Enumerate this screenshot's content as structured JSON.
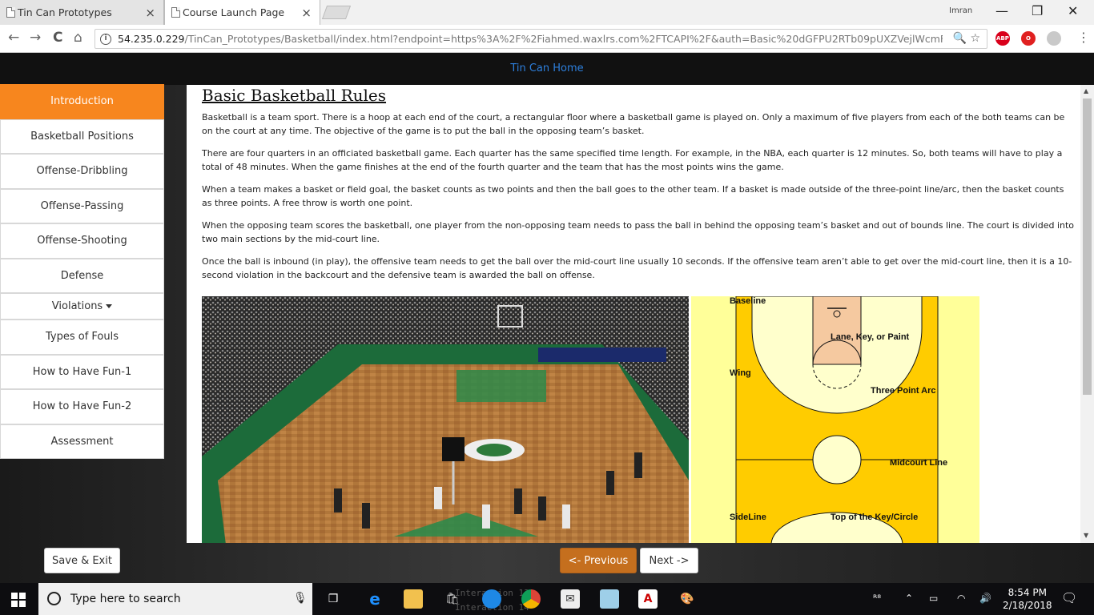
{
  "browser": {
    "tabs": [
      {
        "title": "Tin Can Prototypes",
        "close": "×"
      },
      {
        "title": "Course Launch Page",
        "close": "×"
      }
    ],
    "user_label": "Imran",
    "window_controls": {
      "minimize": "—",
      "maximize": "❐",
      "close": "✕"
    },
    "nav": {
      "back": "←",
      "forward": "→",
      "reload": "C",
      "home": "⌂"
    },
    "url_host": "54.235.0.229",
    "url_path": "/TinCan_Prototypes/Basketball/index.html?endpoint=https%3A%2F%2Fiahmed.waxlrs.com%2FTCAPI%2F&auth=Basic%20dGFPU2RTb09pUXZVejlWcmF2...",
    "omnibox_icons": "🔍 ☆",
    "extensions": [
      {
        "label": "ABP",
        "color": "#d9001b"
      },
      {
        "label": "O",
        "color": "#e02020"
      },
      {
        "label": "",
        "color": "#c9c9c9"
      }
    ],
    "menu": "⋮"
  },
  "page": {
    "top_link": "Tin Can Home",
    "sidebar": [
      {
        "label": "Introduction",
        "active": true
      },
      {
        "label": "Basketball Positions"
      },
      {
        "label": "Offense-Dribbling"
      },
      {
        "label": "Offense-Passing"
      },
      {
        "label": "Offense-Shooting"
      },
      {
        "label": "Defense"
      },
      {
        "label": "Violations",
        "dropdown": true
      },
      {
        "label": "Types of Fouls"
      },
      {
        "label": "How to Have Fun-1"
      },
      {
        "label": "How to Have Fun-2"
      },
      {
        "label": "Assessment"
      }
    ],
    "heading": "Basic Basketball Rules",
    "paragraphs": [
      "Basketball is a team sport. There is a hoop at each end of the court, a rectangular floor where a basketball game is played on. Only a maximum of five players from each of the both teams can be on the court at any time. The objective of the game is to put the ball in the opposing team’s basket.",
      "There are four quarters in an officiated basketball game. Each quarter has the same specified time length. For example, in the NBA, each quarter is 12 minutes. So, both teams will have to play a total of 48 minutes. When the game finishes at the end of the fourth quarter and the team that has the most points wins the game.",
      "When a team makes a basket or field goal, the basket counts as two points and then the ball goes to the other team. If a basket is made outside of the three-point line/arc, then the basket counts as three points. A free throw is worth one point.",
      "When the opposing team scores the basketball, one player from the non-opposing team needs to pass the ball in behind the opposing team’s basket and out of bounds line. The court is divided into two main sections by the mid-court line.",
      "Once the ball is inbound (in play), the offensive team needs to get the ball over the mid-court line usually 10 seconds. If the offensive team aren’t able to get over the mid-court line, then it is a 10-second violation in the backcourt and the defensive team is awarded the ball on offense."
    ],
    "diagram_labels": {
      "baseline": "Baseline",
      "lane": "Lane, Key, or Paint",
      "wing": "Wing",
      "three_point": "Three Point Arc",
      "midcourt": "Midcourt Line",
      "sideline": "SideLine",
      "top_key": "Top of the Key/Circle"
    },
    "buttons": {
      "save": "Save & Exit",
      "previous": "<- Previous",
      "next": "Next ->"
    }
  },
  "taskbar": {
    "search_placeholder": "Type here to search",
    "time": "8:54 PM",
    "date": "2/18/2018",
    "behind_text_1": "Interaction 13",
    "behind_text_2": "Interaction 14"
  }
}
